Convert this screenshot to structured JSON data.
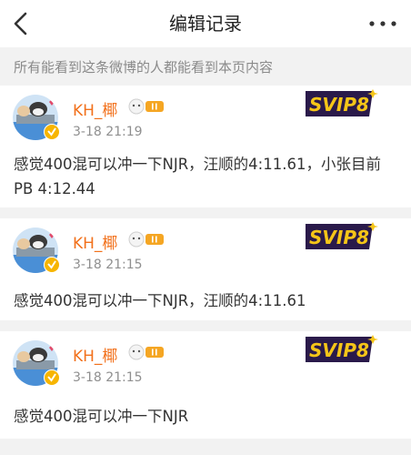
{
  "header": {
    "title": "编辑记录",
    "back_icon": "chevron-left-icon",
    "more_icon": "more-dots-icon"
  },
  "notice": "所有能看到这条微博的人都能看到本页内容",
  "records": [
    {
      "username": "KH_椰",
      "time": "3-18 21:19",
      "text": "感觉400混可以冲一下NJR，汪顺的4:11.61，小张目前PB 4:12.44",
      "svip_label": "SVIP8"
    },
    {
      "username": "KH_椰",
      "time": "3-18 21:15",
      "text": "感觉400混可以冲一下NJR，汪顺的4:11.61",
      "svip_label": "SVIP8"
    },
    {
      "username": "KH_椰",
      "time": "3-18 21:15",
      "text": "感觉400混可以冲一下NJR",
      "svip_label": "SVIP8"
    }
  ],
  "colors": {
    "username": "#f2711c",
    "svip_bg": "#2a1a4a",
    "svip_gold": "#f5c518",
    "vip_badge": "#f7b500",
    "page_bg": "#f2f2f2"
  }
}
